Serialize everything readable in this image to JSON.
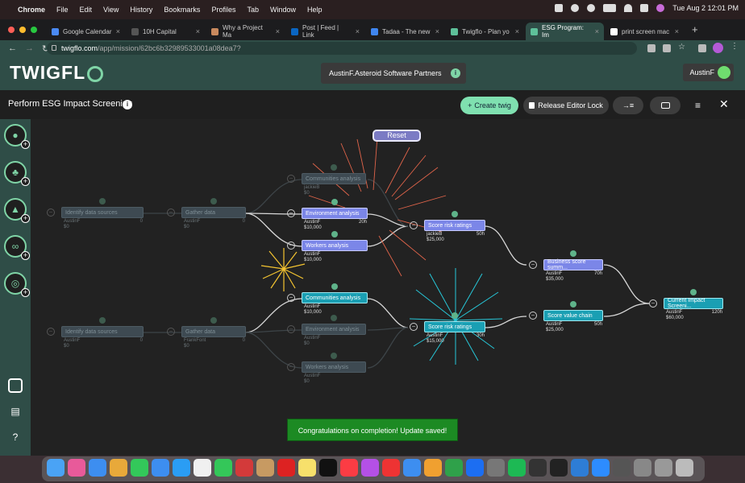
{
  "menubar": {
    "app": "Chrome",
    "items": [
      "File",
      "Edit",
      "View",
      "History",
      "Bookmarks",
      "Profiles",
      "Tab",
      "Window",
      "Help"
    ],
    "datetime": "Tue Aug 2  12:01 PM"
  },
  "tabs": [
    {
      "label": "Google Calendar",
      "color": "#4a8af4"
    },
    {
      "label": "10H Capital",
      "color": "#555555"
    },
    {
      "label": "Why a Project Ma",
      "color": "#c98a5e"
    },
    {
      "label": "Post | Feed | Link",
      "color": "#0a66c2"
    },
    {
      "label": "Tadaa - The new",
      "color": "#3f86f0"
    },
    {
      "label": "Twigflo - Plan yo",
      "color": "#5ec09a"
    },
    {
      "label": "ESG Program: Im",
      "color": "#5ec09a",
      "active": true
    },
    {
      "label": "print screen mac",
      "color": "#ffffff"
    }
  ],
  "address": {
    "host": "twigflo.com",
    "path": "/app/mission/62bc6b32989533001a08dea7?"
  },
  "app": {
    "logo": "TWIGFL",
    "org": "AustinF.Asteroid Software Partners",
    "user": "AustinF"
  },
  "toolbar": {
    "title": "Perform ESG Impact Screening",
    "create": "Create twig",
    "release": "Release Editor Lock"
  },
  "reset": "Reset",
  "toast": "Congratulations on completion! Update saved!",
  "nodes": [
    {
      "id": "n1",
      "label": "Identify data sources",
      "style": "dim",
      "owner": "AustinF",
      "cost": "$0",
      "hours": "0"
    },
    {
      "id": "n2",
      "label": "Gather data",
      "style": "dim",
      "owner": "AustinF",
      "cost": "$0",
      "hours": "0"
    },
    {
      "id": "n3",
      "label": "Communities analysis",
      "style": "dim",
      "owner": "jackieB",
      "cost": "$0",
      "hours": ""
    },
    {
      "id": "n4",
      "label": "Environment analysis",
      "style": "purple",
      "owner": "AustinF",
      "cost": "$10,000",
      "hours": "20h"
    },
    {
      "id": "n5",
      "label": "Workers analysis",
      "style": "purple",
      "owner": "AustinF",
      "cost": "$10,000",
      "hours": ""
    },
    {
      "id": "n6",
      "label": "Score risk ratings",
      "style": "purple",
      "owner": "jackieB",
      "cost": "$25,000",
      "hours": "50h"
    },
    {
      "id": "n7",
      "label": "Business score summ...",
      "style": "purple",
      "owner": "AustinF",
      "cost": "$35,000",
      "hours": "70h"
    },
    {
      "id": "n8",
      "label": "Current Impact Screeni...",
      "style": "teal",
      "owner": "AustinF",
      "cost": "$60,000",
      "hours": "120h"
    },
    {
      "id": "n9",
      "label": "Identify data sources",
      "style": "dim",
      "owner": "AustinF",
      "cost": "$0",
      "hours": "0"
    },
    {
      "id": "n10",
      "label": "Gather data",
      "style": "dim",
      "owner": "FrankFont",
      "cost": "$0",
      "hours": "0"
    },
    {
      "id": "n11",
      "label": "Communities analysis",
      "style": "teal",
      "owner": "AustinF",
      "cost": "$10,000",
      "hours": ""
    },
    {
      "id": "n12",
      "label": "Environment analysis",
      "style": "dim",
      "owner": "AustinF",
      "cost": "$0",
      "hours": ""
    },
    {
      "id": "n13",
      "label": "Workers analysis",
      "style": "dim",
      "owner": "AustinF",
      "cost": "$0",
      "hours": ""
    },
    {
      "id": "n14",
      "label": "Score risk ratings",
      "style": "teal",
      "owner": "AustinF",
      "cost": "$15,000",
      "hours": "30h"
    },
    {
      "id": "n15",
      "label": "Score value chain",
      "style": "teal",
      "owner": "AustinF",
      "cost": "$25,000",
      "hours": "50h"
    }
  ]
}
